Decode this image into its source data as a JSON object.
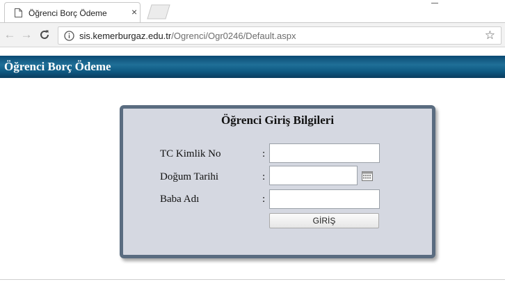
{
  "browser": {
    "tab": {
      "title": "Öğrenci Borç Ödeme",
      "close_icon": "close-icon",
      "page_icon": "page-icon"
    },
    "address_bar": {
      "host": "sis.kemerburgaz.edu.tr",
      "path": "/Ogrenci/Ogr0246/Default.aspx",
      "info_icon": "info-icon",
      "bookmark_icon": "star-icon"
    },
    "nav": {
      "back": "←",
      "forward": "→",
      "reload": "C"
    }
  },
  "page": {
    "header_title": "Öğrenci Borç Ödeme",
    "header_color": "#1f6f97",
    "panel": {
      "title": "Öğrenci Giriş Bilgileri",
      "fields": [
        {
          "label": "TC Kimlik No",
          "colon": ":",
          "value": ""
        },
        {
          "label": "Doğum Tarihi",
          "colon": ":",
          "value": "",
          "calendar_icon": "calendar-icon"
        },
        {
          "label": "Baba Adı",
          "colon": ":",
          "value": ""
        }
      ],
      "submit_label": "GİRİŞ",
      "border_color": "#5a6c80",
      "background_color": "#d5d8e1"
    }
  }
}
